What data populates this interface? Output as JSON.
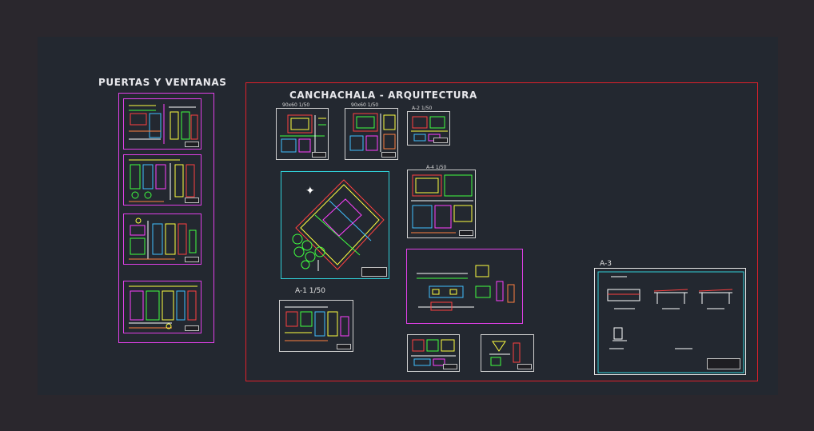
{
  "labels": {
    "doors_windows": "PUERTAS Y VENTANAS",
    "architecture": "CANCHACHALA - ARQUITECTURA",
    "sheet_a1": "A-1  1/50",
    "sheet_a3": "A-3",
    "sheet_a2_top": "A-2   1/50",
    "sheet_a4": "A-4   1/50",
    "sheet_s1": "90x60   1/50",
    "sheet_s2": "90x60   1/50"
  },
  "colors": {
    "background": "#2a272d",
    "model_space": "#232830",
    "red_frame": "#e0202a",
    "magenta_frame": "#e040e8",
    "cyan_frame": "#30d0d8",
    "white_frame": "#e6e6e6"
  }
}
